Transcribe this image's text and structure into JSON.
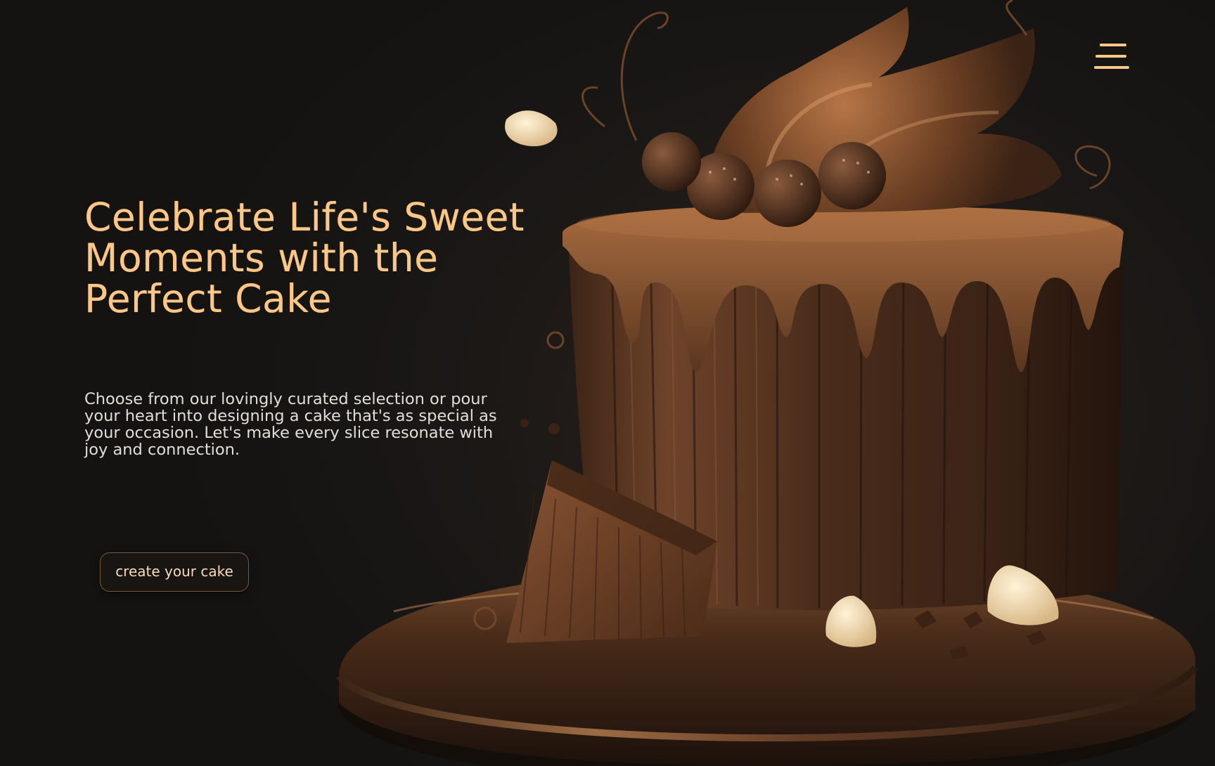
{
  "theme": {
    "accent": "#FDC887",
    "background": "#171615",
    "text": "#E3DDD6",
    "button_border": "#7A5A3F"
  },
  "header": {
    "menu_icon": "hamburger-menu-icon"
  },
  "hero": {
    "title": "Celebrate Life's Sweet Moments with the Perfect Cake",
    "description": "Choose from our lovingly curated selection or pour your heart into designing a cake that's as special as your occasion. Let's make every slice resonate with joy and connection.",
    "cta_label": "create your cake"
  },
  "image": {
    "subject": "chocolate-drip-cake-illustration"
  }
}
